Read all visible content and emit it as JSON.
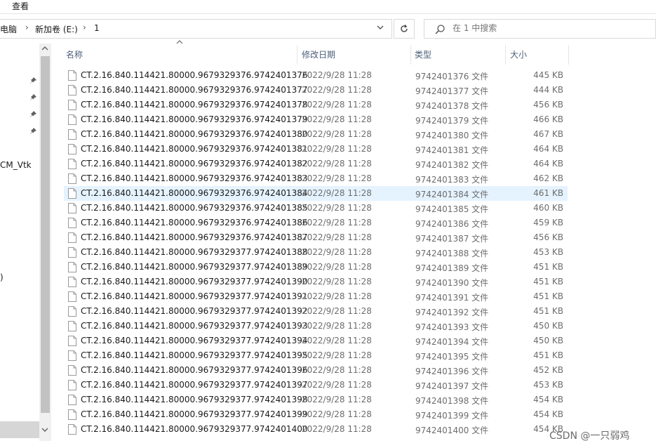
{
  "ribbon": {
    "tab_view": "查看"
  },
  "address": {
    "crumbs": [
      "电脑",
      "新加卷 (E:)",
      "1"
    ],
    "separator": "›"
  },
  "search": {
    "placeholder": "在 1 中搜索"
  },
  "nav": {
    "item_cm_vtk": "CM_Vtk",
    "item_paren": ")"
  },
  "columns": {
    "name": "名称",
    "date": "修改日期",
    "type": "类型",
    "size": "大小"
  },
  "files": [
    {
      "name": "CT.2.16.840.114421.80000.9679329376.9742401376",
      "date": "2022/9/28 11:28",
      "type": "9742401376 文件",
      "size": "445 KB"
    },
    {
      "name": "CT.2.16.840.114421.80000.9679329376.9742401377",
      "date": "2022/9/28 11:28",
      "type": "9742401377 文件",
      "size": "444 KB"
    },
    {
      "name": "CT.2.16.840.114421.80000.9679329376.9742401378",
      "date": "2022/9/28 11:28",
      "type": "9742401378 文件",
      "size": "456 KB"
    },
    {
      "name": "CT.2.16.840.114421.80000.9679329376.9742401379",
      "date": "2022/9/28 11:28",
      "type": "9742401379 文件",
      "size": "466 KB"
    },
    {
      "name": "CT.2.16.840.114421.80000.9679329376.9742401380",
      "date": "2022/9/28 11:28",
      "type": "9742401380 文件",
      "size": "467 KB"
    },
    {
      "name": "CT.2.16.840.114421.80000.9679329376.9742401381",
      "date": "2022/9/28 11:28",
      "type": "9742401381 文件",
      "size": "464 KB"
    },
    {
      "name": "CT.2.16.840.114421.80000.9679329376.9742401382",
      "date": "2022/9/28 11:28",
      "type": "9742401382 文件",
      "size": "464 KB"
    },
    {
      "name": "CT.2.16.840.114421.80000.9679329376.9742401383",
      "date": "2022/9/28 11:28",
      "type": "9742401383 文件",
      "size": "462 KB"
    },
    {
      "name": "CT.2.16.840.114421.80000.9679329376.9742401384",
      "date": "2022/9/28 11:28",
      "type": "9742401384 文件",
      "size": "461 KB",
      "selected": true
    },
    {
      "name": "CT.2.16.840.114421.80000.9679329376.9742401385",
      "date": "2022/9/28 11:28",
      "type": "9742401385 文件",
      "size": "460 KB"
    },
    {
      "name": "CT.2.16.840.114421.80000.9679329376.9742401386",
      "date": "2022/9/28 11:28",
      "type": "9742401386 文件",
      "size": "459 KB"
    },
    {
      "name": "CT.2.16.840.114421.80000.9679329376.9742401387",
      "date": "2022/9/28 11:28",
      "type": "9742401387 文件",
      "size": "456 KB"
    },
    {
      "name": "CT.2.16.840.114421.80000.9679329377.9742401388",
      "date": "2022/9/28 11:28",
      "type": "9742401388 文件",
      "size": "453 KB"
    },
    {
      "name": "CT.2.16.840.114421.80000.9679329377.9742401389",
      "date": "2022/9/28 11:28",
      "type": "9742401389 文件",
      "size": "451 KB"
    },
    {
      "name": "CT.2.16.840.114421.80000.9679329377.9742401390",
      "date": "2022/9/28 11:28",
      "type": "9742401390 文件",
      "size": "451 KB"
    },
    {
      "name": "CT.2.16.840.114421.80000.9679329377.9742401391",
      "date": "2022/9/28 11:28",
      "type": "9742401391 文件",
      "size": "451 KB"
    },
    {
      "name": "CT.2.16.840.114421.80000.9679329377.9742401392",
      "date": "2022/9/28 11:28",
      "type": "9742401392 文件",
      "size": "451 KB"
    },
    {
      "name": "CT.2.16.840.114421.80000.9679329377.9742401393",
      "date": "2022/9/28 11:28",
      "type": "9742401393 文件",
      "size": "450 KB"
    },
    {
      "name": "CT.2.16.840.114421.80000.9679329377.9742401394",
      "date": "2022/9/28 11:28",
      "type": "9742401394 文件",
      "size": "450 KB"
    },
    {
      "name": "CT.2.16.840.114421.80000.9679329377.9742401395",
      "date": "2022/9/28 11:28",
      "type": "9742401395 文件",
      "size": "451 KB"
    },
    {
      "name": "CT.2.16.840.114421.80000.9679329377.9742401396",
      "date": "2022/9/28 11:28",
      "type": "9742401396 文件",
      "size": "452 KB"
    },
    {
      "name": "CT.2.16.840.114421.80000.9679329377.9742401397",
      "date": "2022/9/28 11:28",
      "type": "9742401397 文件",
      "size": "453 KB"
    },
    {
      "name": "CT.2.16.840.114421.80000.9679329377.9742401398",
      "date": "2022/9/28 11:28",
      "type": "9742401398 文件",
      "size": "454 KB"
    },
    {
      "name": "CT.2.16.840.114421.80000.9679329377.9742401399",
      "date": "2022/9/28 11:28",
      "type": "9742401399 文件",
      "size": "454 KB"
    },
    {
      "name": "CT.2.16.840.114421.80000.9679329377.9742401400",
      "date": "2022/9/28 11:28",
      "type": "9742401400 文件",
      "size": "454 KB"
    }
  ],
  "watermark": "CSDN @一只弱鸡",
  "colors": {
    "selected_row": "#e5f3ff",
    "header_text": "#4c607a"
  }
}
